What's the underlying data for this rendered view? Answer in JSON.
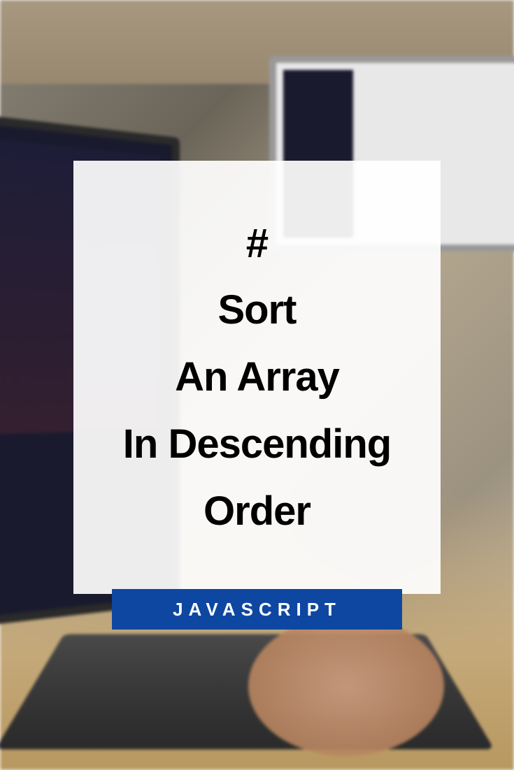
{
  "card": {
    "symbol": "#",
    "line1": "Sort",
    "line2": "An Array",
    "line3": "In Descending",
    "line4": "Order"
  },
  "badge": {
    "label": "JAVASCRIPT"
  }
}
